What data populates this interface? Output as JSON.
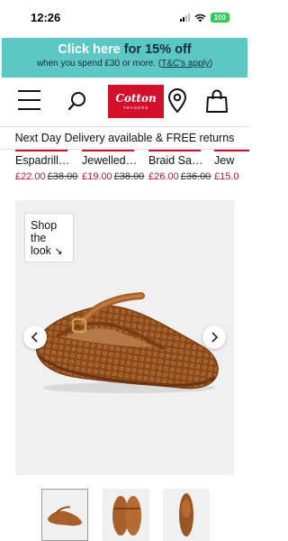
{
  "status_bar": {
    "time": "12:26",
    "battery": "100"
  },
  "promo": {
    "click_here": "Click here",
    "offer": " for 15% off",
    "sub_text": "when you spend £30 or more. (",
    "tc_link": "T&C's apply",
    "sub_end": ")"
  },
  "header": {
    "logo_wordmark": "Cotton",
    "logo_sub": "TRADERS"
  },
  "delivery_banner": "Next Day Delivery available & FREE returns",
  "strip": {
    "items": [
      {
        "name": "Espadrill…",
        "price_now": "£22.00",
        "price_was": "£38.00"
      },
      {
        "name": "Jewelled…",
        "price_now": "£19.00",
        "price_was": "£38.00"
      },
      {
        "name": "Braid Sa…",
        "price_now": "£26.00",
        "price_was": "£36.00"
      },
      {
        "name": "Jew",
        "price_now": "£15.0",
        "price_was": ""
      }
    ]
  },
  "gallery": {
    "shop_look_line1": "Shop",
    "shop_look_line2": "the",
    "shop_look_line3": "look",
    "shop_look_arrow": "↘",
    "active_thumb_index": 0,
    "thumb_count": 3
  },
  "colors": {
    "promo_bg": "#5cc7c3",
    "brand_red": "#d3102c",
    "sale_red": "#c9102e",
    "shoe_tan": "#a8602b"
  }
}
